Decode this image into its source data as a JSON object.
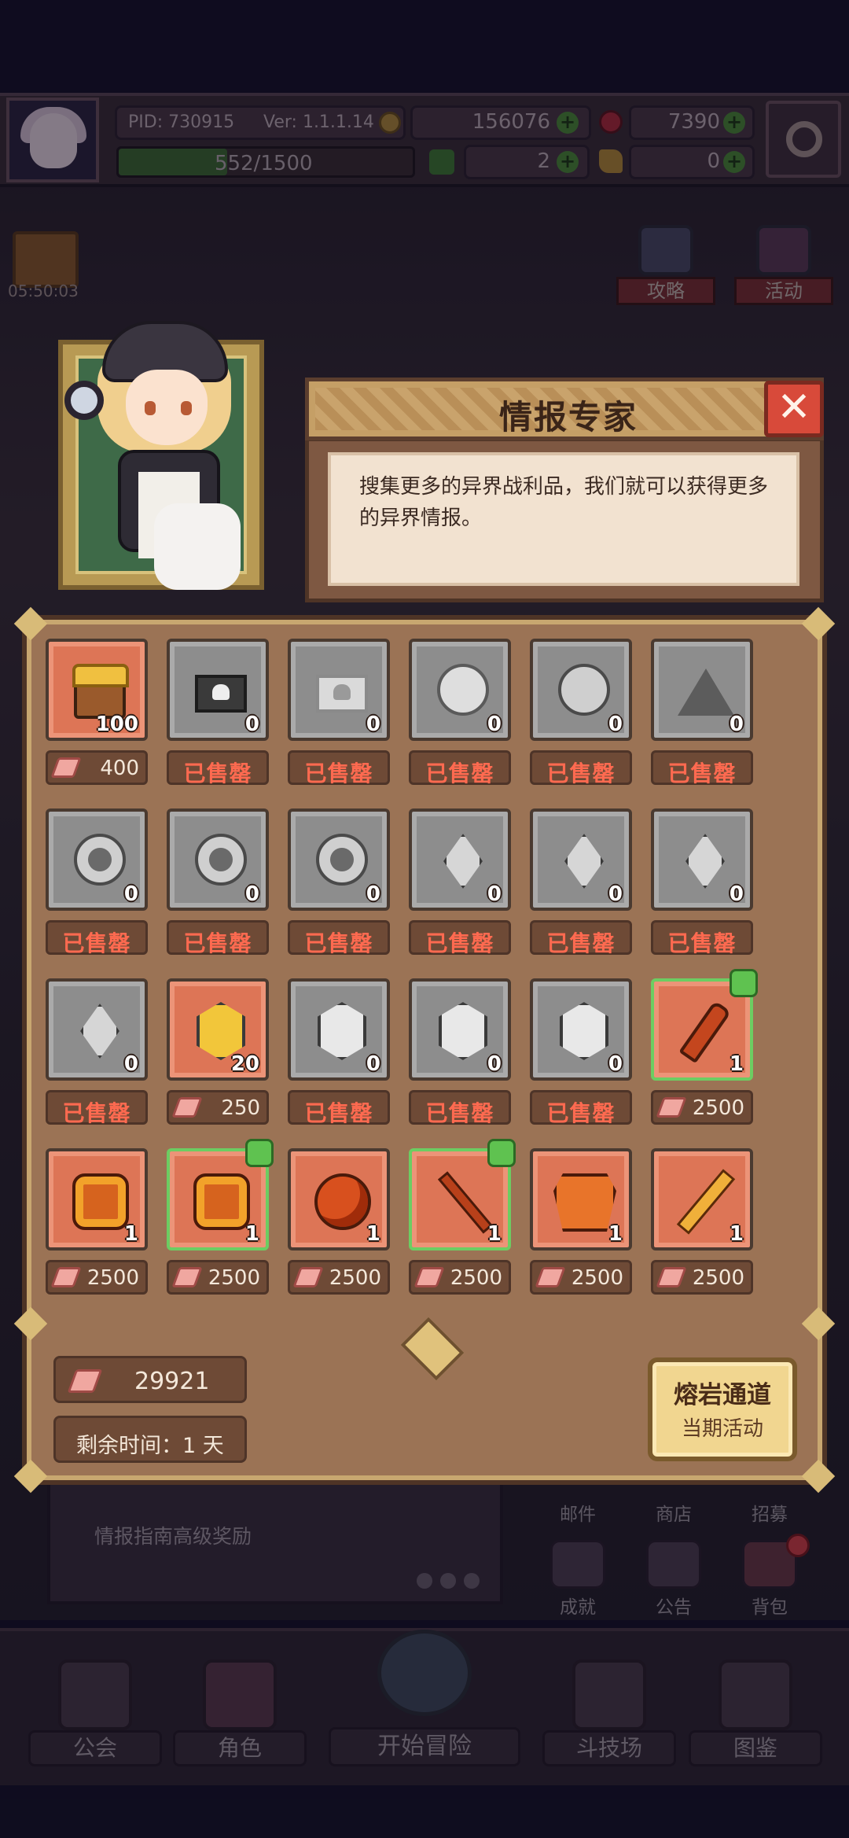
{
  "status_bar": {
    "pid": "PID: 730915",
    "version": "Ver: 1.1.1.14",
    "gold": "156076",
    "gems": "7390",
    "stamina": "552/1500",
    "stamina_fraction": 0.368,
    "clovers": "2",
    "keys": "0"
  },
  "side_left": {
    "timer": "05:50:03"
  },
  "side_right": {
    "strategy_label": "攻略",
    "activity_label": "活动"
  },
  "dialog": {
    "title": "情报专家",
    "close_symbol": "✕",
    "description": "搜集更多的异界战利品，我们就可以获得更多的异界情报。"
  },
  "shop": {
    "sold_out_label": "已售罄",
    "items": [
      {
        "icon": "gold-chest-icon",
        "count": "100",
        "price": "400",
        "sold_out": false,
        "style": "orange",
        "upgrade": false
      },
      {
        "icon": "dark-envelope-icon",
        "count": "0",
        "price": "",
        "sold_out": true,
        "style": "grey",
        "upgrade": false
      },
      {
        "icon": "light-envelope-icon",
        "count": "0",
        "price": "",
        "sold_out": true,
        "style": "grey",
        "upgrade": false
      },
      {
        "icon": "flower-icon",
        "count": "0",
        "price": "",
        "sold_out": true,
        "style": "grey",
        "upgrade": false
      },
      {
        "icon": "pouch-icon",
        "count": "0",
        "price": "",
        "sold_out": true,
        "style": "grey",
        "upgrade": false
      },
      {
        "icon": "pyramid-icon",
        "count": "0",
        "price": "",
        "sold_out": true,
        "style": "grey",
        "upgrade": false
      },
      {
        "icon": "round-gem-icon",
        "count": "0",
        "price": "",
        "sold_out": true,
        "style": "grey",
        "upgrade": false
      },
      {
        "icon": "round-gem-icon",
        "count": "0",
        "price": "",
        "sold_out": true,
        "style": "grey",
        "upgrade": false
      },
      {
        "icon": "round-gem-icon",
        "count": "0",
        "price": "",
        "sold_out": true,
        "style": "grey",
        "upgrade": false
      },
      {
        "icon": "crystal-shard-icon",
        "count": "0",
        "price": "",
        "sold_out": true,
        "style": "grey",
        "upgrade": false
      },
      {
        "icon": "crystal-shard-icon",
        "count": "0",
        "price": "",
        "sold_out": true,
        "style": "grey",
        "upgrade": false
      },
      {
        "icon": "crystal-shard-icon",
        "count": "0",
        "price": "",
        "sold_out": true,
        "style": "grey",
        "upgrade": false
      },
      {
        "icon": "crystal-shard-icon",
        "count": "0",
        "price": "",
        "sold_out": true,
        "style": "grey",
        "upgrade": false
      },
      {
        "icon": "gold-hex-gem-icon",
        "count": "20",
        "price": "250",
        "sold_out": false,
        "style": "orange",
        "upgrade": false
      },
      {
        "icon": "hex-gem-icon",
        "count": "0",
        "price": "",
        "sold_out": true,
        "style": "grey",
        "upgrade": false
      },
      {
        "icon": "hex-gem-icon",
        "count": "0",
        "price": "",
        "sold_out": true,
        "style": "grey",
        "upgrade": false
      },
      {
        "icon": "hex-gem-icon",
        "count": "0",
        "price": "",
        "sold_out": true,
        "style": "grey",
        "upgrade": false
      },
      {
        "icon": "fire-torch-icon",
        "count": "1",
        "price": "2500",
        "sold_out": false,
        "style": "orange",
        "upgrade": true
      },
      {
        "icon": "fire-lantern-icon",
        "count": "1",
        "price": "2500",
        "sold_out": false,
        "style": "orange",
        "upgrade": false
      },
      {
        "icon": "fire-armor-icon",
        "count": "1",
        "price": "2500",
        "sold_out": false,
        "style": "orange",
        "upgrade": true
      },
      {
        "icon": "fire-orb-icon",
        "count": "1",
        "price": "2500",
        "sold_out": false,
        "style": "orange",
        "upgrade": false
      },
      {
        "icon": "fire-staff-icon",
        "count": "1",
        "price": "2500",
        "sold_out": false,
        "style": "orange",
        "upgrade": true
      },
      {
        "icon": "fire-chestplate-icon",
        "count": "1",
        "price": "2500",
        "sold_out": false,
        "style": "orange",
        "upgrade": false
      },
      {
        "icon": "fire-sword-icon",
        "count": "1",
        "price": "2500",
        "sold_out": false,
        "style": "orange",
        "upgrade": false
      }
    ],
    "balance": "29921",
    "remaining_time": "剩余时间：1 天",
    "event_button": {
      "title": "熔岩通道",
      "subtitle": "当期活动"
    }
  },
  "background_ui": {
    "news_text": "情报指南高级奖励",
    "buttons": [
      {
        "label": "邮件"
      },
      {
        "label": "商店"
      },
      {
        "label": "招募"
      },
      {
        "label": "成就"
      },
      {
        "label": "公告"
      },
      {
        "label": "背包"
      }
    ]
  },
  "nav": {
    "guild": "公会",
    "character": "角色",
    "start_adventure": "开始冒险",
    "arena": "斗技场",
    "codex": "图鉴"
  }
}
